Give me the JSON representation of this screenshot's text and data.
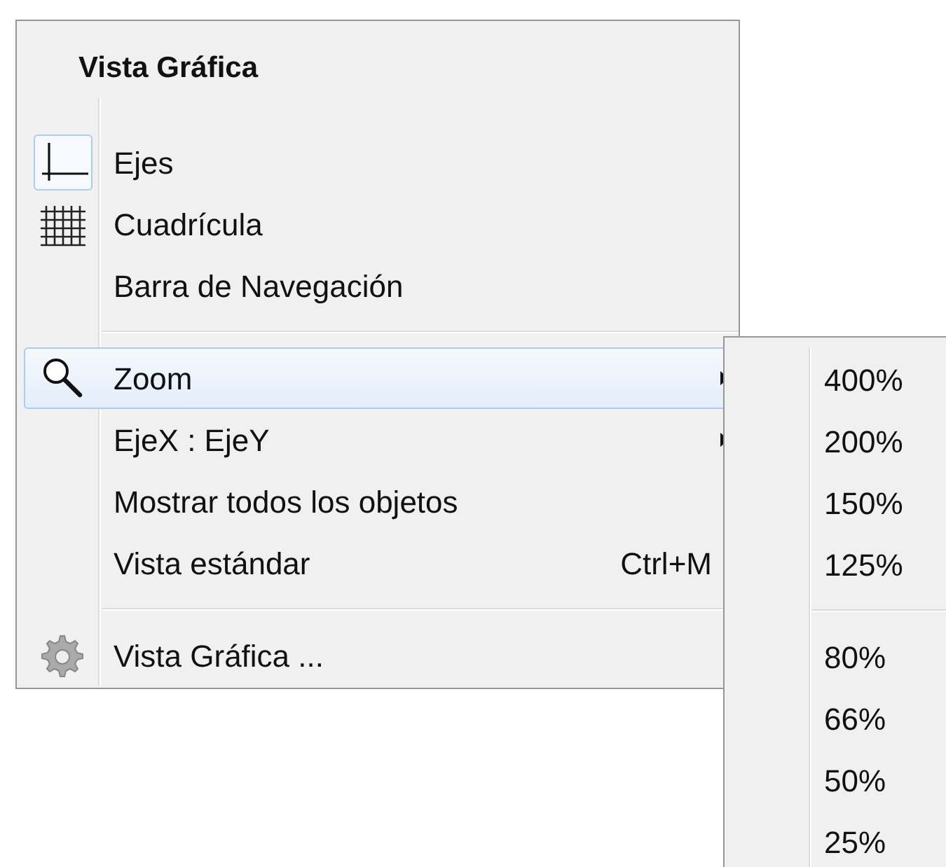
{
  "menu": {
    "title": "Vista Gráfica",
    "sections": [
      [
        {
          "label": "Ejes",
          "kind": "toggle",
          "checked": true,
          "selected": false
        },
        {
          "label": "Cuadrícula",
          "kind": "toggle",
          "checked": false,
          "selected": false
        },
        {
          "label": "Barra de Navegación",
          "kind": "action",
          "selected": false
        }
      ],
      [
        {
          "label": "Zoom",
          "kind": "submenu",
          "selected": true
        },
        {
          "label": "EjeX : EjeY",
          "kind": "submenu",
          "selected": false
        },
        {
          "label": "Mostrar todos los objetos",
          "kind": "action",
          "selected": false
        },
        {
          "label": "Vista estándar",
          "kind": "action",
          "shortcut": "Ctrl+M",
          "selected": false
        }
      ],
      [
        {
          "label": "Vista Gráfica ...",
          "kind": "action",
          "selected": false
        }
      ]
    ]
  },
  "submenu": {
    "sections": [
      [
        {
          "label": "400%",
          "selected": false
        },
        {
          "label": "200%",
          "selected": false
        },
        {
          "label": "150%",
          "selected": false
        },
        {
          "label": "125%",
          "selected": false
        }
      ],
      [
        {
          "label": "80%",
          "selected": false
        },
        {
          "label": "66%",
          "selected": false
        },
        {
          "label": "50%",
          "selected": false
        },
        {
          "label": "25%",
          "selected": false
        }
      ]
    ]
  }
}
